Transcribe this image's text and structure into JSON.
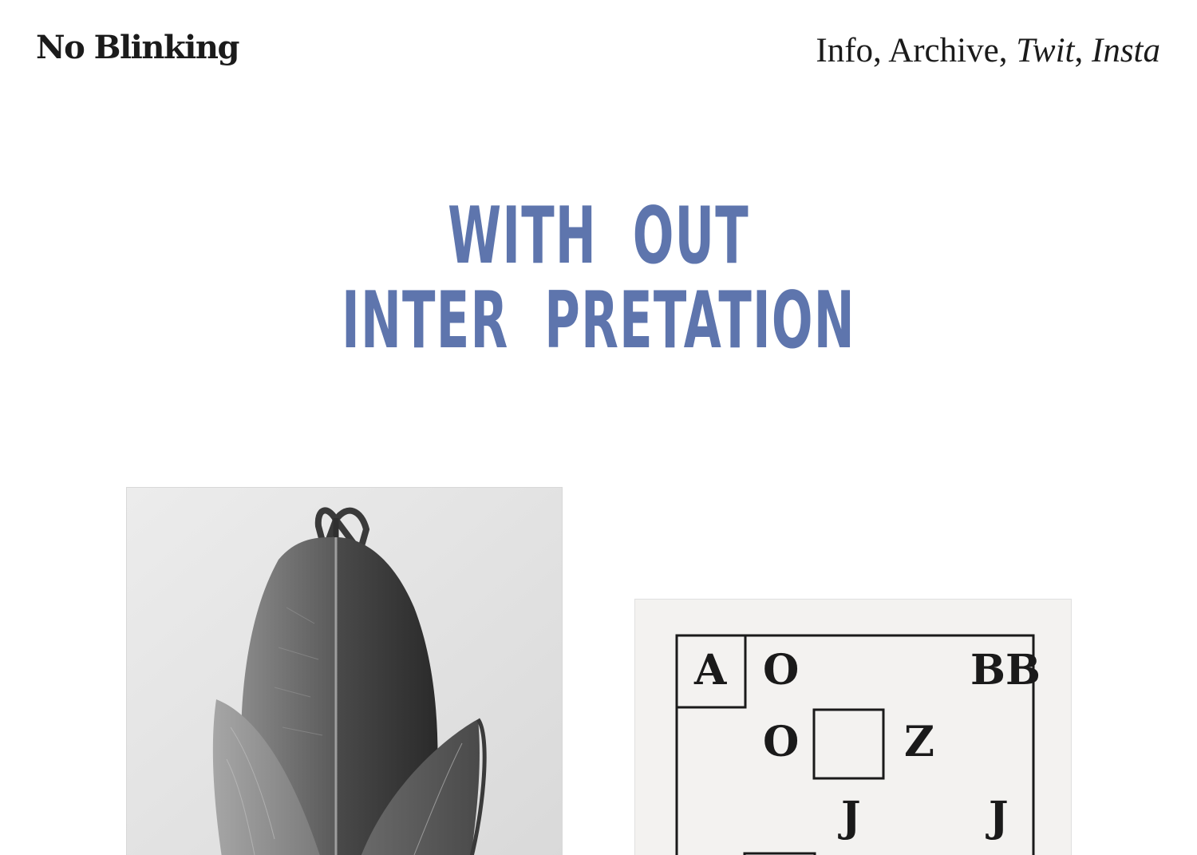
{
  "header": {
    "site_title": "No Blinking",
    "nav": {
      "info": "Info",
      "archive": "Archive",
      "twit": "Twit",
      "insta": "Insta",
      "separator": ","
    }
  },
  "main": {
    "headline_line1": "WITH  OUT",
    "headline_line2": "INTER  PRETATION",
    "accent_color": "#5e75ad",
    "images": [
      {
        "name": "plant-bud-photo",
        "type": "black-and-white photograph of a plant bud"
      },
      {
        "name": "letter-diagram",
        "letters": {
          "a": "A",
          "o1": "O",
          "bb": "BB",
          "o2": "O",
          "z": "Z",
          "j1": "J",
          "j2": "J"
        }
      }
    ]
  }
}
